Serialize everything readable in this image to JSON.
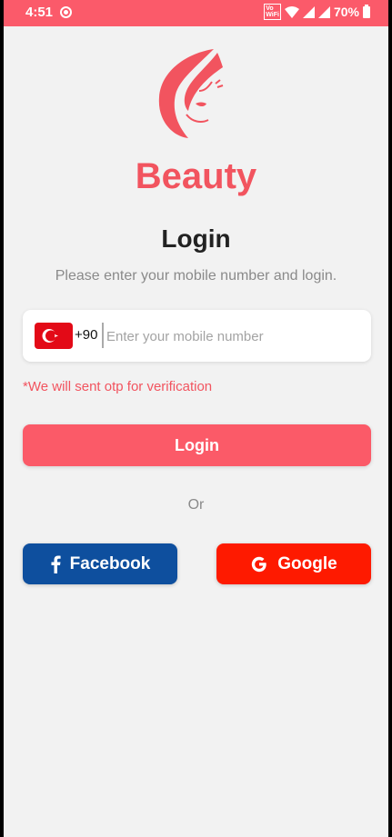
{
  "status_bar": {
    "time": "4:51",
    "wifi_badge": "VoLTE WiFi",
    "battery": "70%"
  },
  "brand": {
    "name": "Beauty",
    "accent": "#f2545f"
  },
  "login": {
    "title": "Login",
    "subtitle": "Please enter your mobile number and login.",
    "dial_code": "+90",
    "phone_placeholder": "Enter your mobile number",
    "otp_note": "*We will sent otp for verification",
    "login_button": "Login",
    "or_text": "Or",
    "facebook_button": "Facebook",
    "google_button": "Google"
  },
  "icons": {
    "flag": "turkey-flag-icon",
    "facebook": "facebook-icon",
    "google": "google-icon",
    "logo": "woman-face-logo"
  },
  "colors": {
    "status_bar": "#fb5a6a",
    "login_button": "#fb5a68",
    "facebook": "#0e4f9e",
    "google": "#fe1a00"
  }
}
